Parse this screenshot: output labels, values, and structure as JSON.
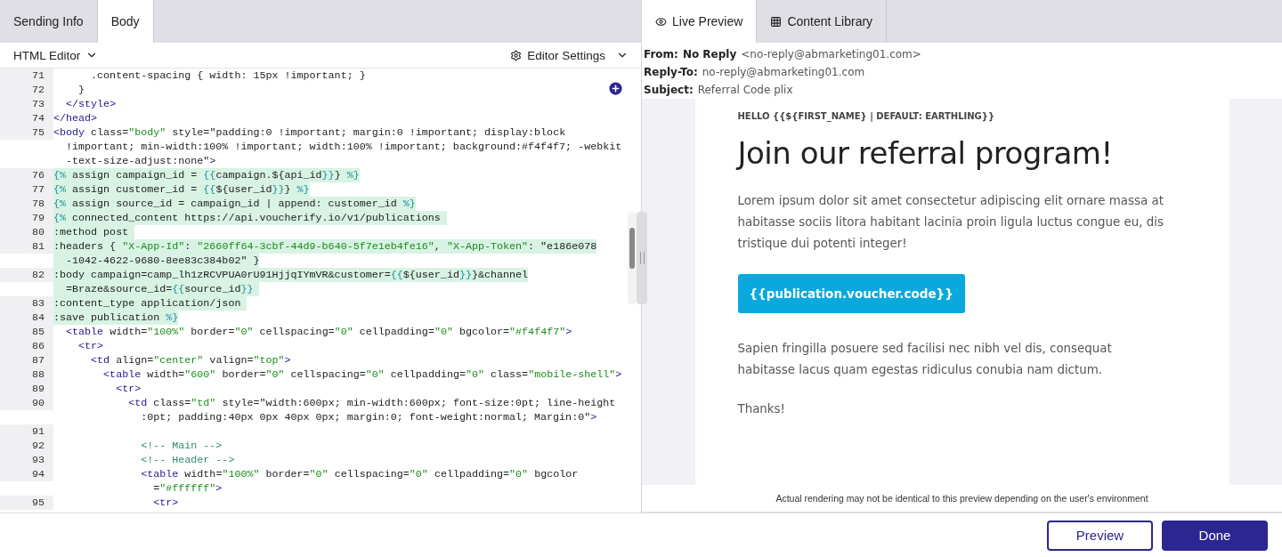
{
  "left_tabs": [
    {
      "label": "Sending Info",
      "selected": false
    },
    {
      "label": "Body",
      "selected": true
    }
  ],
  "editor_toolbar": {
    "mode": "HTML Editor",
    "settings": "Editor Settings"
  },
  "code_lines": [
    {
      "number": "71",
      "kind": "markup",
      "rows": [
        "      .content-spacing { width: 15px !important; }"
      ]
    },
    {
      "number": "72",
      "kind": "markup",
      "rows": [
        "    }"
      ]
    },
    {
      "number": "73",
      "kind": "markup",
      "rows": [
        "  </style>"
      ]
    },
    {
      "number": "74",
      "kind": "markup",
      "rows": [
        "</head>"
      ]
    },
    {
      "number": "75",
      "kind": "markup",
      "rows": [
        "<body class=\"body\" style=\"padding:0 !important; margin:0 !important; display:block",
        "  !important; min-width:100% !important; width:100% !important; background:#f4f4f7; -webkit",
        "  -text-size-adjust:none\">"
      ]
    },
    {
      "number": "76",
      "kind": "liquid",
      "rows": [
        "{% assign campaign_id = {{campaign.${api_id}}} %}"
      ]
    },
    {
      "number": "77",
      "kind": "liquid",
      "rows": [
        "{% assign customer_id = {{${user_id}}} %}"
      ]
    },
    {
      "number": "78",
      "kind": "liquid",
      "rows": [
        "{% assign source_id = campaign_id | append: customer_id %}"
      ]
    },
    {
      "number": "79",
      "kind": "liquid",
      "rows": [
        "{% connected_content https://api.voucherify.io/v1/publications "
      ]
    },
    {
      "number": "80",
      "kind": "liquid",
      "rows": [
        ":method post "
      ]
    },
    {
      "number": "81",
      "kind": "liquid",
      "rows": [
        ":headers { \"X-App-Id\": \"2660ff64-3cbf-44d9-b640-5f7e1eb4fe16\", \"X-App-Token\": \"e186e078",
        "  -1042-4622-9680-8ee83c384b02\" }"
      ]
    },
    {
      "number": "82",
      "kind": "liquid",
      "rows": [
        ":body campaign=camp_lh1zRCVPUA0rU91HjjqIYmVR&customer={{${user_id}}}&channel",
        "  =Braze&source_id={{source_id}} "
      ]
    },
    {
      "number": "83",
      "kind": "liquid",
      "rows": [
        ":content_type application/json "
      ]
    },
    {
      "number": "84",
      "kind": "liquid",
      "rows": [
        ":save publication %}"
      ]
    },
    {
      "number": "85",
      "kind": "markup",
      "rows": [
        "  <table width=\"100%\" border=\"0\" cellspacing=\"0\" cellpadding=\"0\" bgcolor=\"#f4f4f7\">"
      ]
    },
    {
      "number": "86",
      "kind": "markup",
      "rows": [
        "    <tr>"
      ]
    },
    {
      "number": "87",
      "kind": "markup",
      "rows": [
        "      <td align=\"center\" valign=\"top\">"
      ]
    },
    {
      "number": "88",
      "kind": "markup",
      "rows": [
        "        <table width=\"600\" border=\"0\" cellspacing=\"0\" cellpadding=\"0\" class=\"mobile-shell\">"
      ]
    },
    {
      "number": "89",
      "kind": "markup",
      "rows": [
        "          <tr>"
      ]
    },
    {
      "number": "90",
      "kind": "markup",
      "rows": [
        "            <td class=\"td\" style=\"width:600px; min-width:600px; font-size:0pt; line-height",
        "              :0pt; padding:40px 0px 40px 0px; margin:0; font-weight:normal; Margin:0\">"
      ]
    },
    {
      "number": "91"
    },
    {
      "number": "92",
      "kind": "comment",
      "rows": [
        "              <!-- Main -->"
      ]
    },
    {
      "number": "93",
      "kind": "comment",
      "rows": [
        "              <!-- Header -->"
      ]
    },
    {
      "number": "94",
      "kind": "markup",
      "rows": [
        "              <table width=\"100%\" border=\"0\" cellspacing=\"0\" cellpadding=\"0\" bgcolor",
        "                =\"#ffffff\">"
      ]
    },
    {
      "number": "95",
      "kind": "markup",
      "rows": [
        "                <tr>"
      ]
    }
  ],
  "right_tabs": [
    {
      "label": "Live Preview",
      "selected": true
    },
    {
      "label": "Content Library",
      "selected": false
    }
  ],
  "email_header": {
    "from_label": "From:",
    "from_name": "No Reply",
    "from_address": "<no-reply@abmarketing01.com>",
    "reply_to_label": "Reply-To:",
    "reply_to": "no-reply@abmarketing01.com",
    "subject_label": "Subject:",
    "subject": "Referral Code plix"
  },
  "email_body": {
    "greeting": "HELLO {{${FIRST_NAME} | DEFAULT: EARTHLING}}",
    "heading": "Join our referral program!",
    "paragraph_1": "Lorem ipsum dolor sit amet consectetur adipiscing elit ornare massa at habitasse sociis litora habitant lacinia proin ligula luctus congue eu, dis tristique dui potenti integer!",
    "button": "{{publication.voucher.code}}",
    "paragraph_2": "Sapien fringilla posuere sed facilisi nec nibh vel dis, consequat habitasse lacus quam egestas ridiculus conubia nam dictum.",
    "closing": "Thanks!"
  },
  "disclaimer": "Actual rendering may not be identical to this preview depending on the user's environment",
  "footer_buttons": [
    {
      "label": "Preview",
      "kind": "secondary"
    },
    {
      "label": "Done",
      "kind": "primary"
    }
  ]
}
